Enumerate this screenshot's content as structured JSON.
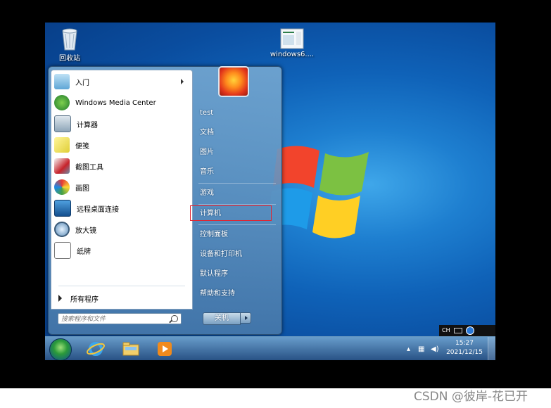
{
  "desktop_icons": [
    {
      "label": "回收站",
      "icon": "recycle-bin-icon"
    },
    {
      "label": "windows6....",
      "icon": "document-icon"
    }
  ],
  "start_menu": {
    "pinned": [
      {
        "label": "入门",
        "icon": "getting-started-icon",
        "has_submenu": true
      },
      {
        "label": "Windows Media Center",
        "icon": "media-center-icon"
      },
      {
        "label": "计算器",
        "icon": "calculator-icon"
      },
      {
        "label": "便笺",
        "icon": "sticky-notes-icon"
      },
      {
        "label": "截图工具",
        "icon": "snipping-tool-icon"
      },
      {
        "label": "画图",
        "icon": "paint-icon"
      },
      {
        "label": "远程桌面连接",
        "icon": "remote-desktop-icon"
      },
      {
        "label": "放大镜",
        "icon": "magnifier-icon"
      },
      {
        "label": "纸牌",
        "icon": "solitaire-icon"
      }
    ],
    "all_programs": "所有程序",
    "search_placeholder": "搜索程序和文件",
    "right_items": [
      {
        "label": "test"
      },
      {
        "label": "文档"
      },
      {
        "label": "图片"
      },
      {
        "label": "音乐"
      },
      {
        "label": "游戏"
      },
      {
        "label": "计算机",
        "highlighted": true
      },
      {
        "label": "控制面板"
      },
      {
        "label": "设备和打印机"
      },
      {
        "label": "默认程序"
      },
      {
        "label": "帮助和支持"
      }
    ],
    "shutdown_label": "关机"
  },
  "taskbar": {
    "pinned": [
      {
        "icon": "internet-explorer-icon"
      },
      {
        "icon": "file-explorer-icon"
      },
      {
        "icon": "media-player-icon"
      }
    ],
    "clock_time": "15:27",
    "clock_date": "2021/12/15"
  },
  "language_bar": {
    "label": "CH"
  },
  "watermark": "CSDN @彼岸-花已开",
  "colors": {
    "highlight_border": "#e3232f",
    "desktop_blue": "#0f62b8"
  }
}
